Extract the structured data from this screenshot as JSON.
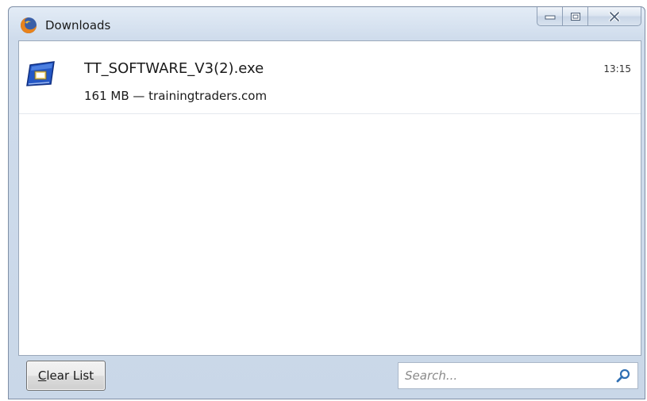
{
  "window": {
    "title": "Downloads",
    "icon": "firefox-logo-icon"
  },
  "caption_buttons": {
    "minimize_icon": "minimize-icon",
    "maximize_icon": "maximize-icon",
    "close_icon": "close-icon"
  },
  "downloads": [
    {
      "file_name": "TT_SOFTWARE_V3(2).exe",
      "status": "161 MB — trainingtraders.com",
      "time": "13:15",
      "icon": "executable-file-icon"
    }
  ],
  "footer": {
    "clear_access_key": "C",
    "clear_rest": "lear List",
    "search_placeholder": "Search...",
    "search_value": "",
    "search_icon": "search-icon"
  },
  "colors": {
    "frame": "#cfdcec",
    "client_bg": "#ffffff",
    "border": "#9aa8ba"
  }
}
